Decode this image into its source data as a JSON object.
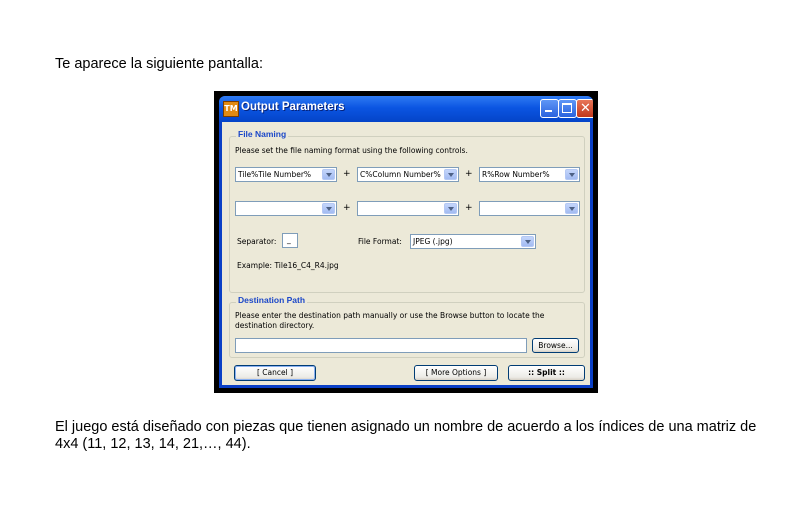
{
  "document": {
    "intro": "Te aparece la siguiente pantalla:",
    "outro": "El juego está diseñado con piezas que tienen asignado un nombre de acuerdo a los índices de una matriz de 4x4 (11, 12, 13, 14, 21,…, 44)."
  },
  "dialog": {
    "icon_text": "TM",
    "title": "Output Parameters",
    "file_naming": {
      "title": "File Naming",
      "description": "Please set the file naming format using the following controls.",
      "row1": [
        "Tile%Tile Number%",
        "C%Column Number%",
        "R%Row Number%"
      ],
      "row2": [
        "",
        "",
        ""
      ],
      "plus": "+",
      "separator_label": "Separator:",
      "separator_value": "_",
      "file_format_label": "File Format:",
      "file_format_value": "JPEG (.jpg)",
      "example": "Example: Tile16_C4_R4.jpg"
    },
    "destination": {
      "title": "Destination Path",
      "description": "Please enter the destination path manually or use the Browse button to locate the destination directory.",
      "path_value": "",
      "browse_label": "Browse..."
    },
    "buttons": {
      "cancel": "[ Cancel ]",
      "more_options": "[ More Options ]",
      "split": ":: Split ::"
    }
  }
}
